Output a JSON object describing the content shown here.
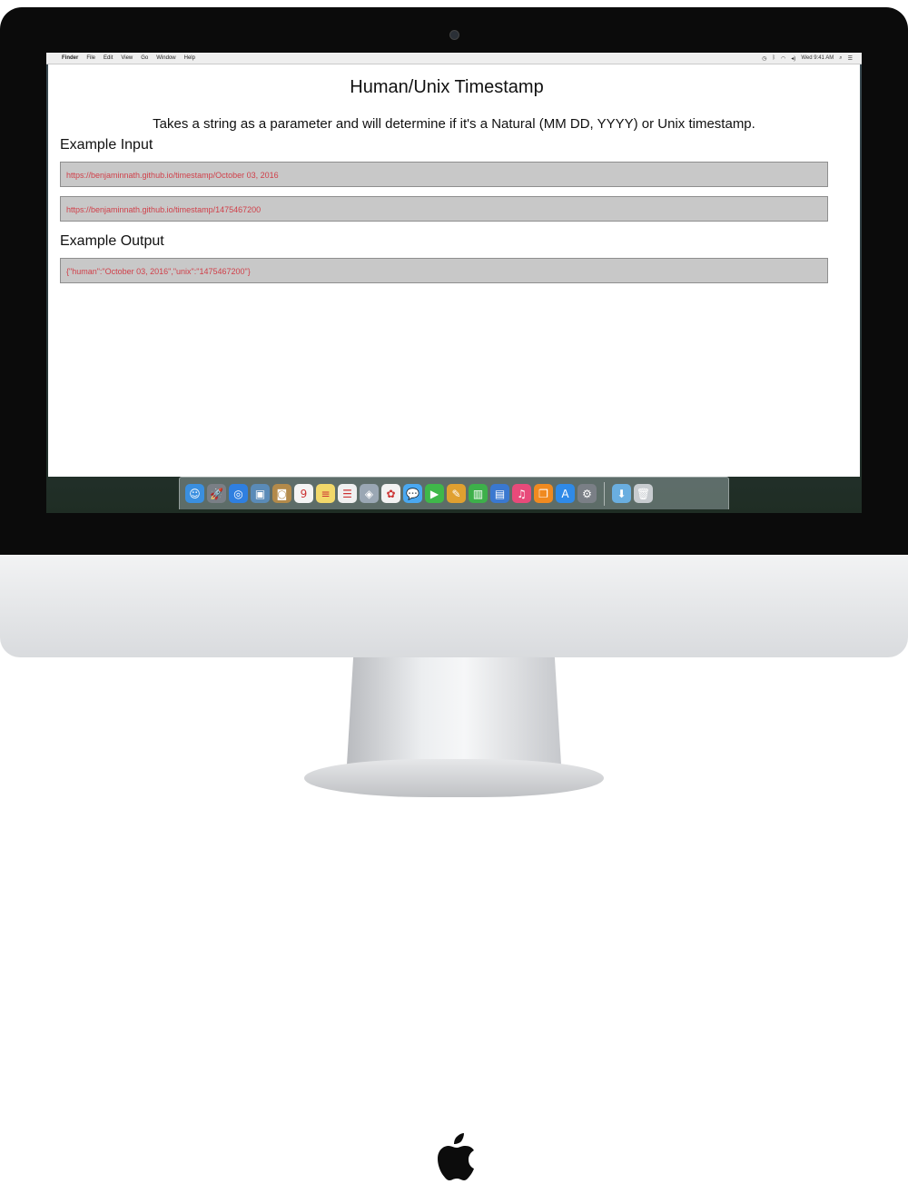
{
  "menubar": {
    "apple_glyph": "",
    "app_name": "Finder",
    "menus": [
      "File",
      "Edit",
      "View",
      "Go",
      "Window",
      "Help"
    ],
    "clock": "Wed 9:41 AM"
  },
  "page": {
    "title": "Human/Unix Timestamp",
    "description": "Takes a string as a parameter and will determine if it's a Natural (MM DD, YYYY) or Unix timestamp.",
    "input_heading": "Example Input",
    "inputs": [
      "https://benjaminnath.github.io/timestamp/October 03, 2016",
      "https://benjaminnath.github.io/timestamp/1475467200"
    ],
    "output_heading": "Example Output",
    "output": "{\"human\":\"October 03, 2016\",\"unix\":\"1475467200\"}"
  },
  "dock": {
    "icons": [
      {
        "name": "finder-icon",
        "glyph": "☺",
        "color": "#3a8fe0"
      },
      {
        "name": "launchpad-icon",
        "glyph": "🚀",
        "color": "#7a7f86"
      },
      {
        "name": "safari-icon",
        "glyph": "◎",
        "color": "#2f7fe0"
      },
      {
        "name": "preview-icon",
        "glyph": "▣",
        "color": "#5a8bb8"
      },
      {
        "name": "contacts-icon",
        "glyph": "◙",
        "color": "#b38a4a"
      },
      {
        "name": "calendar-icon",
        "glyph": "9",
        "color": "#f4f4f4"
      },
      {
        "name": "notes-icon",
        "glyph": "≡",
        "color": "#f2d86a"
      },
      {
        "name": "reminders-icon",
        "glyph": "☰",
        "color": "#f0f0f0"
      },
      {
        "name": "photo-booth-icon",
        "glyph": "◈",
        "color": "#9aa7b4"
      },
      {
        "name": "photos-icon",
        "glyph": "✿",
        "color": "#f2f2f2"
      },
      {
        "name": "messages-icon",
        "glyph": "💬",
        "color": "#4aa8f0"
      },
      {
        "name": "facetime-icon",
        "glyph": "▶",
        "color": "#3fb84a"
      },
      {
        "name": "keynote-icon",
        "glyph": "✎",
        "color": "#e0a030"
      },
      {
        "name": "numbers-icon",
        "glyph": "▥",
        "color": "#3db04a"
      },
      {
        "name": "keynote-stand-icon",
        "glyph": "▤",
        "color": "#3a78d0"
      },
      {
        "name": "itunes-icon",
        "glyph": "♫",
        "color": "#e84a7a"
      },
      {
        "name": "ibooks-icon",
        "glyph": "❐",
        "color": "#f08a20"
      },
      {
        "name": "app-store-icon",
        "glyph": "A",
        "color": "#2f8ae8"
      },
      {
        "name": "system-preferences-icon",
        "glyph": "⚙",
        "color": "#7a7f86"
      }
    ],
    "trailing_icons": [
      {
        "name": "downloads-folder-icon",
        "glyph": "⬇",
        "color": "#6aaee0"
      },
      {
        "name": "trash-icon",
        "glyph": "🗑",
        "color": "#c8ccd0"
      }
    ]
  },
  "colors": {
    "code_text": "#d0404a",
    "code_box_bg": "#c8c8c8"
  }
}
